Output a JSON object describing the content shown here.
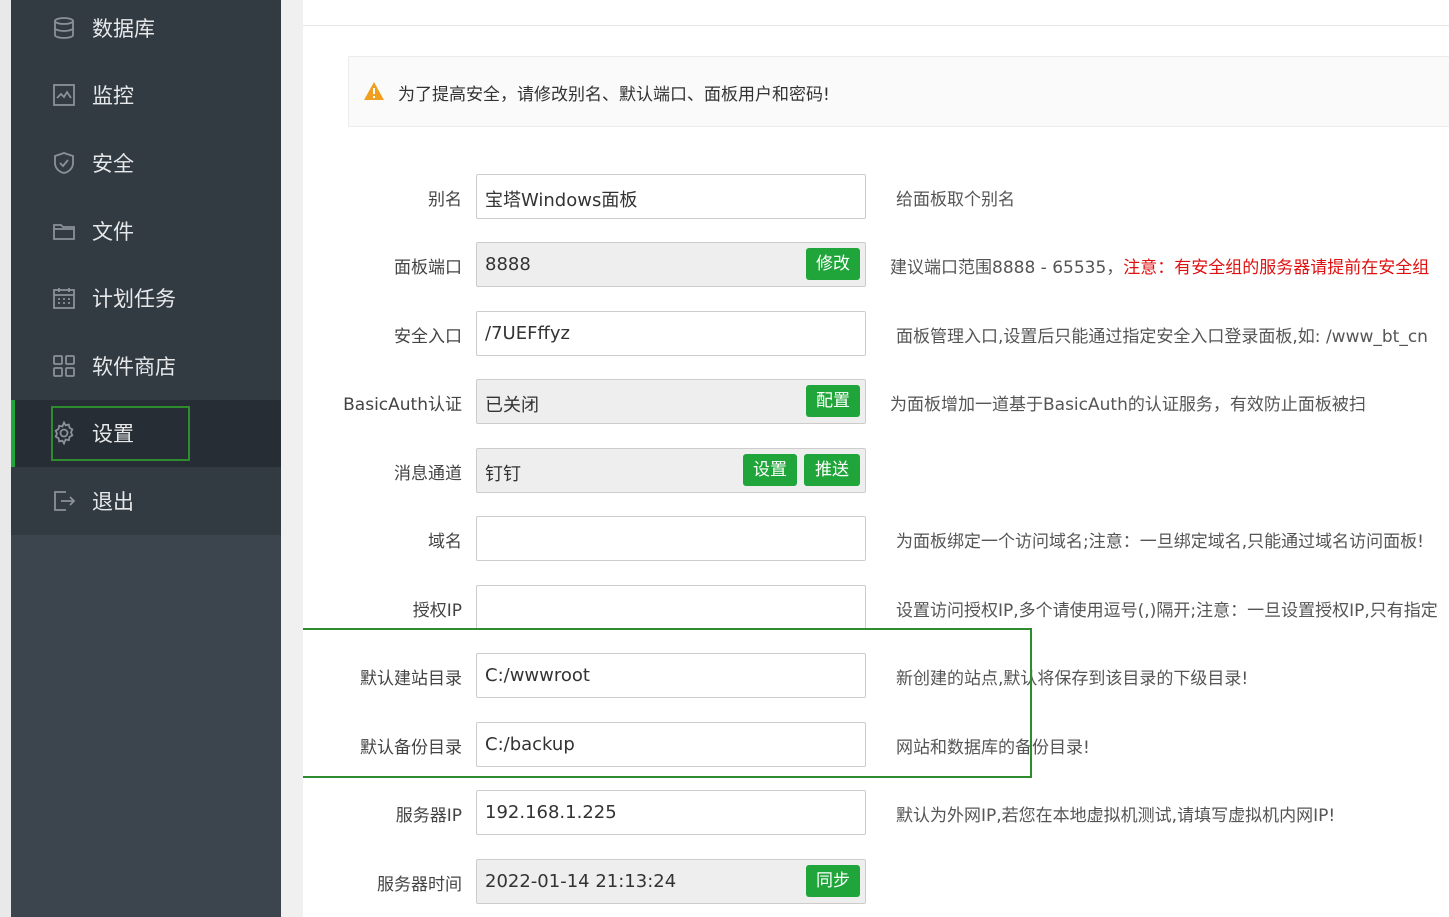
{
  "sidebar": {
    "items": [
      {
        "label": "数据库",
        "icon": "database-icon"
      },
      {
        "label": "监控",
        "icon": "monitor-icon"
      },
      {
        "label": "安全",
        "icon": "shield-icon"
      },
      {
        "label": "文件",
        "icon": "folder-icon"
      },
      {
        "label": "计划任务",
        "icon": "calendar-icon"
      },
      {
        "label": "软件商店",
        "icon": "grid-icon"
      },
      {
        "label": "设置",
        "icon": "gear-icon",
        "active": true
      },
      {
        "label": "退出",
        "icon": "logout-icon"
      }
    ]
  },
  "main": {
    "notice": "为了提高安全，请修改别名、默认端口、面板用户和密码!",
    "fields": {
      "alias": {
        "label": "别名",
        "value": "宝塔Windows面板",
        "hint": "给面板取个别名"
      },
      "port": {
        "label": "面板端口",
        "value": "8888",
        "button": "修改",
        "hint": "建议端口范围8888 - 65535，",
        "hint_red": "注意：有安全组的服务器请提前在安全组"
      },
      "entry": {
        "label": "安全入口",
        "value": "/7UEFffyz",
        "hint": "面板管理入口,设置后只能通过指定安全入口登录面板,如: /www_bt_cn"
      },
      "basicauth": {
        "label": "BasicAuth认证",
        "value": "已关闭",
        "button": "配置",
        "hint": "为面板增加一道基于BasicAuth的认证服务，有效防止面板被扫"
      },
      "message": {
        "label": "消息通道",
        "value": "钉钉",
        "button1": "设置",
        "button2": "推送"
      },
      "domain": {
        "label": "域名",
        "value": "",
        "hint": "为面板绑定一个访问域名;注意：一旦绑定域名,只能通过域名访问面板!"
      },
      "auth_ip": {
        "label": "授权IP",
        "value": "",
        "hint": "设置访问授权IP,多个请使用逗号(,)隔开;注意：一旦设置授权IP,只有指定"
      },
      "site_dir": {
        "label": "默认建站目录",
        "value": "C:/wwwroot",
        "hint": "新创建的站点,默认将保存到该目录的下级目录!"
      },
      "backup_dir": {
        "label": "默认备份目录",
        "value": "C:/backup",
        "hint": "网站和数据库的备份目录!"
      },
      "server_ip": {
        "label": "服务器IP",
        "value": "192.168.1.225",
        "hint": "默认为外网IP,若您在本地虚拟机测试,请填写虚拟机内网IP!"
      },
      "server_time": {
        "label": "服务器时间",
        "value": "2022-01-14 21:13:24",
        "button": "同步"
      }
    }
  },
  "colors": {
    "accent": "#20a53a",
    "sidebar": "#3c444d",
    "highlight": "#2e8b2e",
    "warning": "#f0a020",
    "danger": "#e01010"
  }
}
